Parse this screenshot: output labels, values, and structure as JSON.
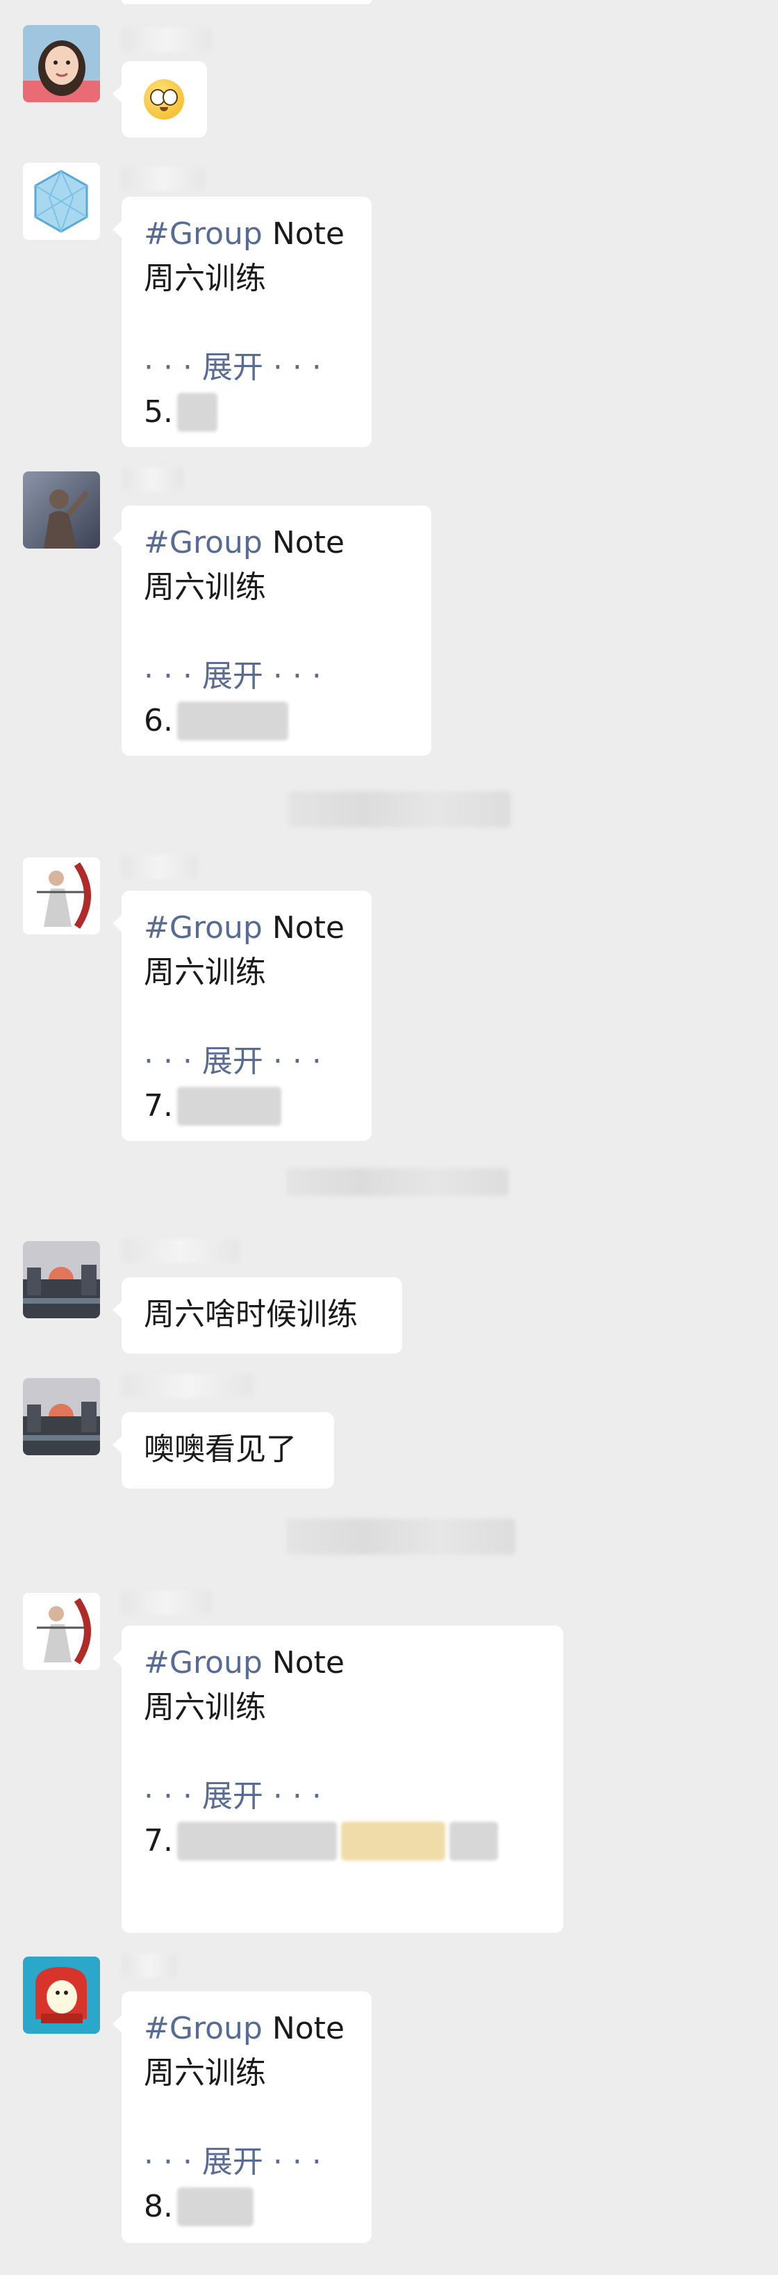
{
  "messages": [
    {
      "type": "emoji",
      "emoji_name": "pleading-face-emoji"
    },
    {
      "type": "note",
      "note_label": "Note",
      "hash": "#Group",
      "line2": "周六训练",
      "expand": "· · · 展开 · · ·",
      "num": "5."
    },
    {
      "type": "note",
      "note_label": "Note",
      "hash": "#Group",
      "line2": "周六训练",
      "expand": "· · · 展开 · · ·",
      "num": "6."
    },
    {
      "type": "note",
      "note_label": "Note",
      "hash": "#Group",
      "line2": "周六训练",
      "expand": "· · · 展开 · · ·",
      "num": "7."
    },
    {
      "type": "text",
      "text": "周六啥时候训练"
    },
    {
      "type": "text",
      "text": "噢噢看见了"
    },
    {
      "type": "note",
      "note_label": "Note",
      "hash": "#Group",
      "line2": "周六训练",
      "expand": "· · · 展开 · · ·",
      "num": "7."
    },
    {
      "type": "note",
      "note_label": "Note",
      "hash": "#Group",
      "line2": "周六训练",
      "expand": "· · · 展开 · · ·",
      "num": "8."
    }
  ]
}
